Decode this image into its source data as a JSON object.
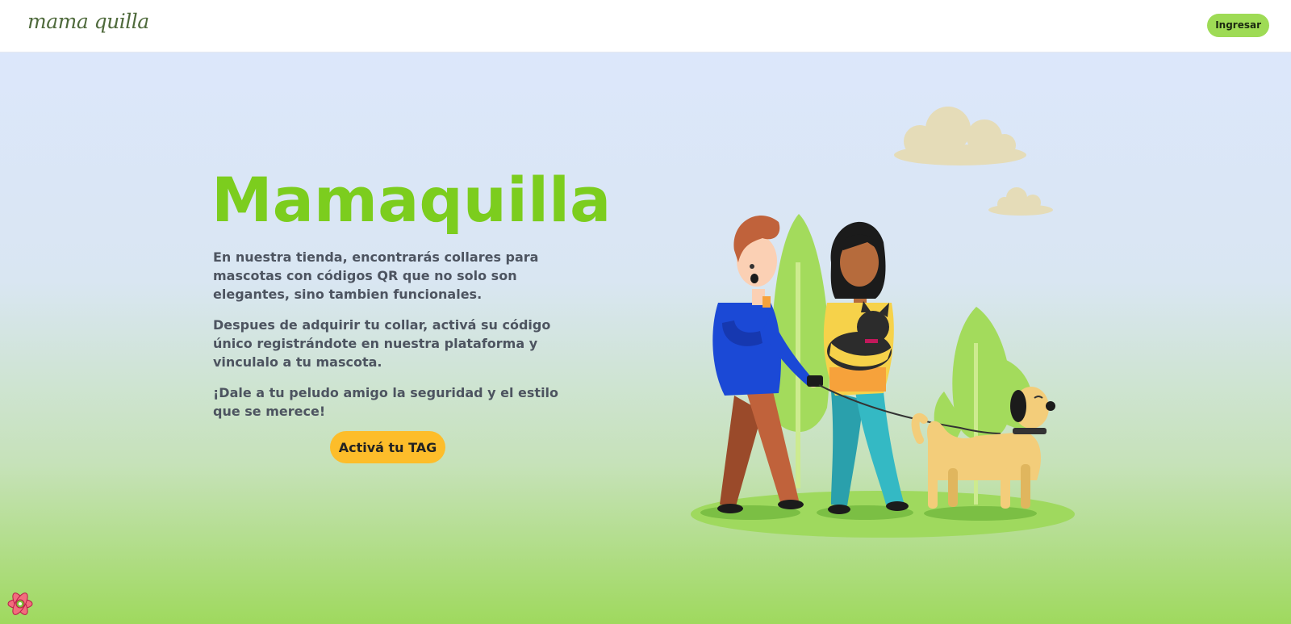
{
  "navbar": {
    "brand": "mama quilla",
    "login_label": "Ingresar"
  },
  "hero": {
    "title": "Mamaquilla",
    "paragraph_1": "En nuestra tienda, encontrarás collares para mascotas con códigos QR que no solo son elegantes, sino tambien funcionales.",
    "paragraph_2": "Despues de adquirir tu collar, activá su código único registrándote en nuestra plataforma y vinculalo a tu mascota.",
    "paragraph_3": "¡Dale a tu peludo amigo la seguridad y el estilo que se merece!",
    "cta_label": "Activá tu TAG"
  },
  "illustration": {
    "subject": "two-people-walking-pets"
  },
  "colors": {
    "brand_green": "#7ccd1e",
    "login_button": "#9edb55",
    "cta_button": "#fdbd2a",
    "text": "#4d5460",
    "brand_text": "#4f6a3c"
  },
  "icons": [
    "react-devtools-icon"
  ]
}
